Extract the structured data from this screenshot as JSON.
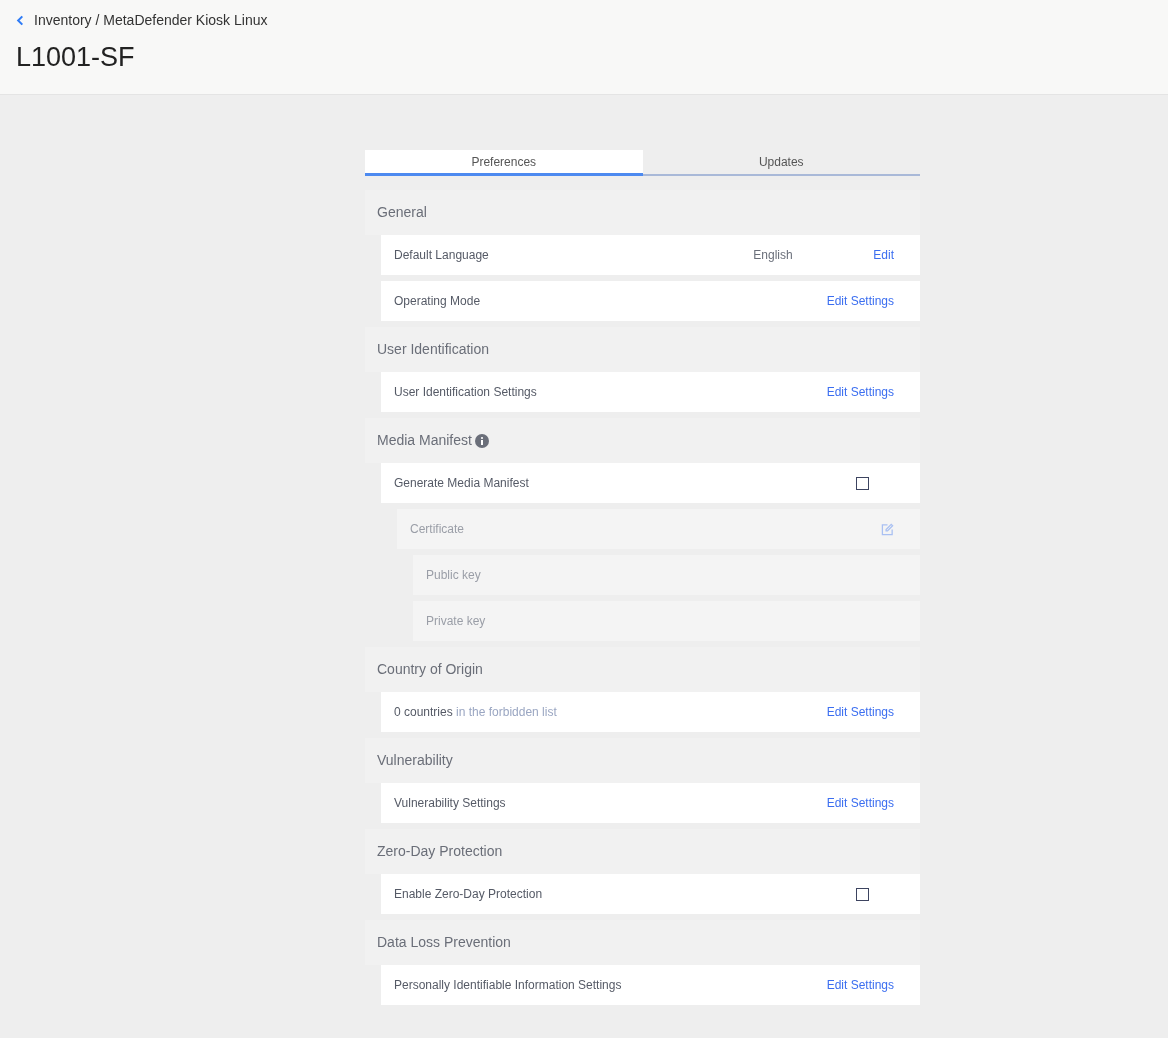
{
  "breadcrumb": "Inventory / MetaDefender Kiosk Linux",
  "title": "L1001-SF",
  "tabs": [
    {
      "label": "Preferences",
      "selected": true
    },
    {
      "label": "Updates",
      "selected": false
    }
  ],
  "sections": [
    {
      "title": "General",
      "info": false,
      "rows": [
        {
          "kind": "action",
          "label": "Default Language",
          "value": "English",
          "action": "Edit"
        },
        {
          "kind": "action",
          "label": "Operating Mode",
          "action": "Edit Settings"
        }
      ]
    },
    {
      "title": "User Identification",
      "info": false,
      "rows": [
        {
          "kind": "action",
          "label": "User Identification Settings",
          "action": "Edit Settings"
        }
      ]
    },
    {
      "title": "Media Manifest",
      "info": true,
      "rows": [
        {
          "kind": "checkbox",
          "label": "Generate Media Manifest",
          "checked": false
        },
        {
          "kind": "group",
          "label": "Certificate",
          "disabled": true,
          "children": [
            {
              "label": "Public key"
            },
            {
              "label": "Private key"
            }
          ]
        }
      ]
    },
    {
      "title": "Country of Origin",
      "info": false,
      "rows": [
        {
          "kind": "action",
          "label": "0 countries",
          "note": "in the forbidden list",
          "action": "Edit Settings"
        }
      ]
    },
    {
      "title": "Vulnerability",
      "info": false,
      "rows": [
        {
          "kind": "action",
          "label": "Vulnerability Settings",
          "action": "Edit Settings"
        }
      ]
    },
    {
      "title": "Zero-Day Protection",
      "info": false,
      "rows": [
        {
          "kind": "checkbox",
          "label": "Enable Zero-Day Protection",
          "checked": false
        }
      ]
    },
    {
      "title": "Data Loss Prevention",
      "info": false,
      "rows": [
        {
          "kind": "action",
          "label": "Personally Identifiable Information Settings",
          "action": "Edit Settings"
        }
      ]
    }
  ]
}
